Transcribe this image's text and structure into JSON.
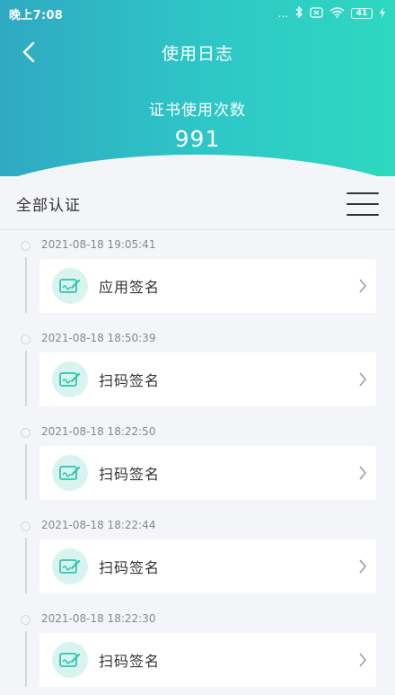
{
  "status_bar": {
    "time": "晚上7:08",
    "dots": "...",
    "battery": "41"
  },
  "nav": {
    "title": "使用日志"
  },
  "summary": {
    "label": "证书使用次数",
    "count": "991"
  },
  "filter": {
    "label": "全部认证"
  },
  "entries": [
    {
      "timestamp": "2021-08-18 19:05:41",
      "label": "应用签名"
    },
    {
      "timestamp": "2021-08-18 18:50:39",
      "label": "扫码签名"
    },
    {
      "timestamp": "2021-08-18 18:22:50",
      "label": "扫码签名"
    },
    {
      "timestamp": "2021-08-18 18:22:44",
      "label": "扫码签名"
    },
    {
      "timestamp": "2021-08-18 18:22:30",
      "label": "扫码签名"
    }
  ],
  "colors": {
    "header_start": "#2fa9c3",
    "header_end": "#2ed8c0",
    "accent": "#2ec5b0",
    "icon_bg": "#d9f4ef"
  }
}
